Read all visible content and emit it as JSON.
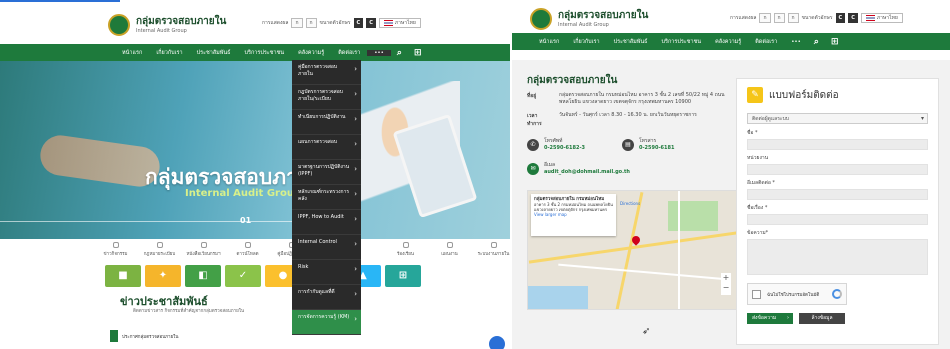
{
  "left": {
    "header": {
      "title": "กลุ่มตรวจสอบภายใน",
      "subtitle": "Internal Audit Group",
      "font_small": "ก",
      "font_mid": "ก",
      "font_large": "ก",
      "contrast_label": "การแสดงผล",
      "contrast_a": "C",
      "contrast_b": "C",
      "lang_label": "ภาษาไทย",
      "size_label": "ขนาดตัวอักษร"
    },
    "nav": {
      "home": "หน้าแรก",
      "about": "เกี่ยวกับเรา",
      "info": "ประชาสัมพันธ์",
      "services": "บริการประชาชน",
      "knowledge": "คลังความรู้",
      "contact": "ติดต่อเรา",
      "more": "•••",
      "search_icon": "search-icon",
      "sitemap_icon": "sitemap-icon"
    },
    "hero": {
      "title": "กลุ่มตรวจสอบภายใน",
      "subtitle": "Internal Audit Group",
      "indicator": "01"
    },
    "quicklinks": [
      "ข่าวกิจกรรม",
      "กฎหมายระเบียบ",
      "หนังสือเวียนกรมฯ",
      "ดาวน์โหลด",
      "คู่มือปฏิบัติงาน",
      "ร้องเรียน",
      "แผนงาน",
      "ระบบงานภายใน"
    ],
    "tiles": [
      {
        "glyph": "■",
        "color": "#7cb342"
      },
      {
        "glyph": "✦",
        "color": "#f5b52b"
      },
      {
        "glyph": "◧",
        "color": "#43a047"
      },
      {
        "glyph": "✓",
        "color": "#8bc34a"
      },
      {
        "glyph": "●",
        "color": "#fbc02d"
      },
      {
        "glyph": "■",
        "color": "#26a69a"
      },
      {
        "glyph": "▲",
        "color": "#29b6f6"
      },
      {
        "glyph": "⊞",
        "color": "#26a69a"
      }
    ],
    "news": {
      "title": "ข่าวประชาสัมพันธ์",
      "subtitle": "ติดตามข่าวสาร กิจกรรมที่สำคัญจากกลุ่มตรวจสอบภายใน",
      "item": "ประกาศกลุ่มตรวจสอบภายใน"
    },
    "dropdown": [
      "คู่มือการตรวจสอบภายใน",
      "กฎบัตรการตรวจสอบภายใน/ระเบียบ",
      "ทำเนียบการปฏิบัติงาน",
      "แผนการตรวจสอบ",
      "มาตรฐานการปฏิบัติงาน (IPPF)",
      "หลักเกณฑ์กระทรวงการคลัง",
      "IPPF, How to Audit",
      "Internal Control",
      "Risk",
      "การกำกับดูแลที่ดี",
      "การจัดการความรู้ (KM)"
    ]
  },
  "right": {
    "header": {
      "title": "กลุ่มตรวจสอบภายใน",
      "subtitle": "Internal Audit Group",
      "contrast_label": "การแสดงผล",
      "size_label": "ขนาดตัวอักษร",
      "lang_label": "ภาษาไทย",
      "font_small": "ก",
      "font_mid": "ก",
      "font_large": "ก",
      "contrast_a": "C",
      "contrast_b": "C"
    },
    "nav": {
      "home": "หน้าแรก",
      "about": "เกี่ยวกับเรา",
      "info": "ประชาสัมพันธ์",
      "services": "บริการประชาชน",
      "knowledge": "คลังความรู้",
      "contact": "ติดต่อเรา",
      "more": "•••"
    },
    "contact": {
      "title": "กลุ่มตรวจสอบภายใน",
      "address_key": "ที่อยู่",
      "address": "กลุ่มตรวจสอบภายใน กรมหม่อนไหม อาคาร 3 ชั้น 2 เลขที่ 50/22 หมู่ 4 ถนนพหลโยธิน แขวงลาดยาว เขตจตุจักร กรุงเทพมหานคร 10900",
      "hours_key": "เวลาทำการ",
      "hours": "วันจันทร์ - วันศุกร์ เวลา 8.30 - 16.30 น. ยกเว้นวันหยุดราชการ",
      "phone_label": "โทรศัพท์",
      "phone": "0-2590-6182-3",
      "fax_label": "โทรสาร",
      "fax": "0-2590-6181",
      "email_label": "อีเมล",
      "email": "audit_doh@dohmail.mail.go.th"
    },
    "map": {
      "place": "กลุ่มตรวจสอบภายใน กรมหม่อนไหม",
      "address": "อาคาร 3 ชั้น 2 กรมหม่อนไหม ถนนพหลโยธิน แขวงลาดยาว เขตจตุจักร กรุงเทพมหานคร",
      "directions": "Directions",
      "larger_map": "View larger map",
      "plus": "+",
      "minus": "−"
    },
    "form": {
      "title": "แบบฟอร์มติดต่อ",
      "select_value": "ติดต่อผู้ดูแลระบบ",
      "name_label": "ชื่อ *",
      "org_label": "หน่วยงาน",
      "email_label": "อีเมลติดต่อ *",
      "subject_label": "ชื่อเรื่อง *",
      "message_label": "ข้อความ*",
      "captcha_text": "ฉันไม่ใช่โปรแกรมอัตโนมัติ",
      "submit": "ส่งข้อความ",
      "reset": "ล้างข้อมูล"
    }
  }
}
